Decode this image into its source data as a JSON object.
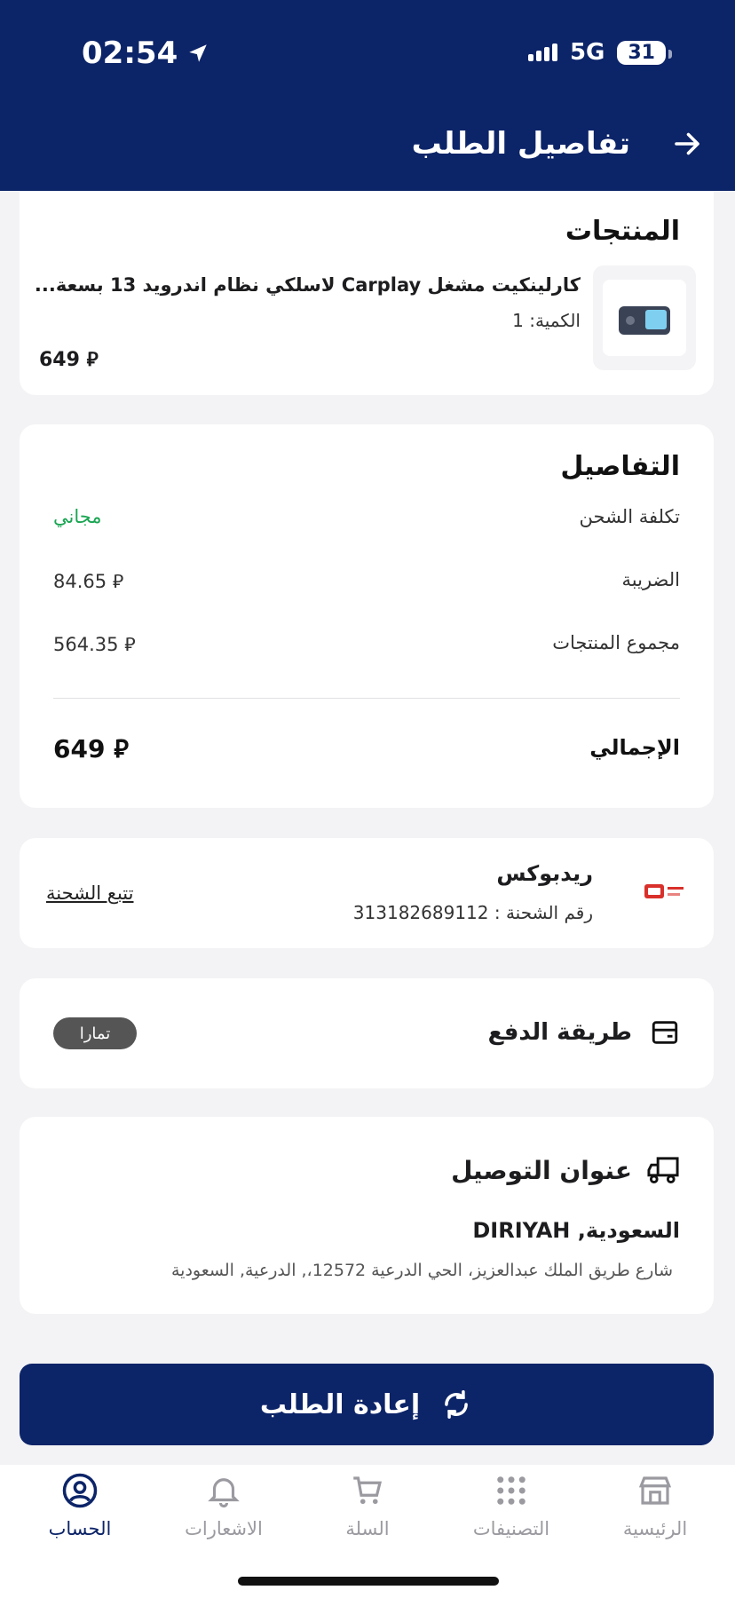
{
  "status": {
    "time": "02:54",
    "network": "5G",
    "battery": "31"
  },
  "header": {
    "title": "تفاصيل الطلب"
  },
  "products": {
    "title": "المنتجات",
    "item": {
      "name": "كارلينكيت مشغل Carplay لاسلكي نظام اندرويد 13 بسعة...",
      "quantity": "الكمية: 1",
      "price": "649 ⃁"
    }
  },
  "details": {
    "title": "التفاصيل",
    "shipping_label": "تكلفة الشحن",
    "shipping_value": "مجاني",
    "tax_label": "الضريبة",
    "tax_value": "84.65 ⃁",
    "subtotal_label": "مجموع المنتجات",
    "subtotal_value": "564.35 ⃁",
    "total_label": "الإجمالي",
    "total_value": "649 ⃁"
  },
  "shipment": {
    "courier": "ريدبوكس",
    "tracking_number": "رقم الشحنة : 313182689112",
    "track_link": "تتبع الشحنة"
  },
  "payment": {
    "title": "طريقة الدفع",
    "method": "تمارا"
  },
  "address": {
    "title": "عنوان التوصيل",
    "city": "السعودية, DIRIYAH",
    "street": "شارع طريق الملك عبدالعزيز، الحي الدرعية 12572،, الدرعية, السعودية"
  },
  "actions": {
    "reorder": "إعادة الطلب"
  },
  "tabs": [
    {
      "label": "الحساب",
      "icon": "account-icon",
      "active": true
    },
    {
      "label": "الاشعارات",
      "icon": "bell-icon"
    },
    {
      "label": "السلة",
      "icon": "cart-icon"
    },
    {
      "label": "التصنيفات",
      "icon": "grid-icon"
    },
    {
      "label": "الرئيسية",
      "icon": "store-icon"
    }
  ],
  "colors": {
    "primary": "#0c2468",
    "free": "#1aa552",
    "inactive_tab": "#9a9aa0"
  }
}
